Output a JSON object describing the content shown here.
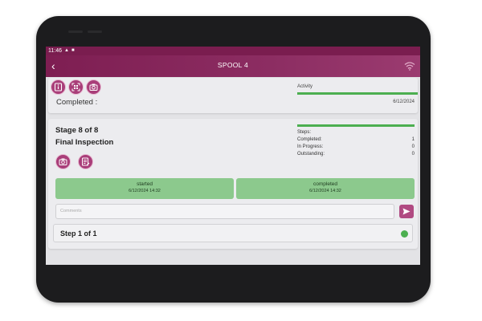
{
  "status_bar": {
    "time": "11:46"
  },
  "app_bar": {
    "title": "SPOOL 4"
  },
  "top_card": {
    "completed_label": "Completed :",
    "activity_label": "Activity",
    "activity_progress": 1.0,
    "completed_date": "6/12/2024"
  },
  "stage": {
    "title": "Stage 8 of 8",
    "name": "Final Inspection",
    "steps_progress": 1.0,
    "stats": [
      {
        "label": "Steps:",
        "value": ""
      },
      {
        "label": "Completed:",
        "value": "1"
      },
      {
        "label": "In Progress:",
        "value": "0"
      },
      {
        "label": "Outstanding:",
        "value": "0"
      }
    ],
    "started": {
      "label": "started",
      "time": "6/12/2024 14:32"
    },
    "completed": {
      "label": "completed",
      "time": "6/12/2024 14:32"
    },
    "comments_placeholder": "Comments",
    "step_label": "Step 1 of 1"
  },
  "colors": {
    "appbar": "#7e1e52",
    "accent": "#a93e79",
    "success": "#4caf50",
    "status_box": "#8cc98d"
  },
  "icons": [
    "back-icon",
    "wifi-icon",
    "info-icon",
    "qr-scan-icon",
    "camera-icon",
    "notes-icon",
    "send-icon"
  ]
}
